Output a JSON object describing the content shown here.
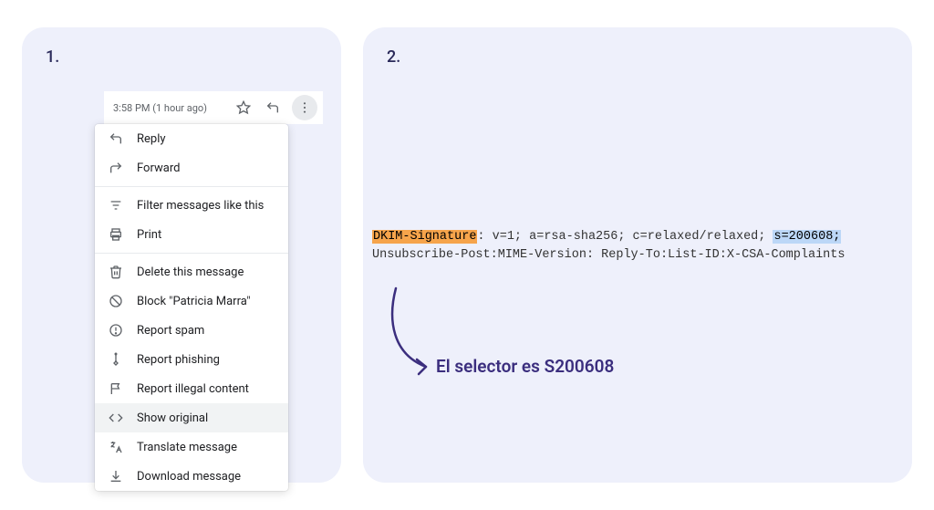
{
  "panel1": {
    "number": "1."
  },
  "panel2": {
    "number": "2."
  },
  "gmail": {
    "timestamp": "3:58 PM (1 hour ago)",
    "menu": {
      "reply": "Reply",
      "forward": "Forward",
      "filter": "Filter messages like this",
      "print": "Print",
      "delete": "Delete this message",
      "block": "Block \"Patricia Marra\"",
      "report_spam": "Report spam",
      "report_phishing": "Report phishing",
      "report_illegal": "Report illegal content",
      "show_original": "Show original",
      "translate": "Translate message",
      "download": "Download message"
    }
  },
  "code": {
    "dkim_label": "DKIM-Signature",
    "line1_mid": ": v=1; a=rsa-sha256; c=relaxed/relaxed; ",
    "selector": "s=200608;",
    "line2": "Unsubscribe-Post:MIME-Version: Reply-To:List-ID:X-CSA-Complaints"
  },
  "annotation": "El selector es S200608"
}
